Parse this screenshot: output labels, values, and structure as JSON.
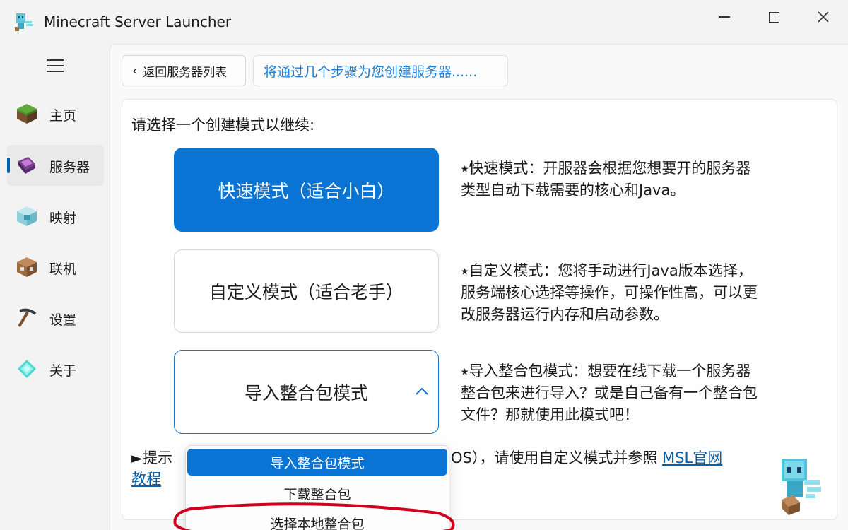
{
  "window": {
    "title": "Minecraft Server Launcher",
    "app_icon": "allay-icon",
    "controls": [
      "minimize-icon",
      "maximize-icon",
      "close-icon"
    ]
  },
  "sidebar": {
    "menu_icon": "hamburger-icon",
    "items": [
      {
        "label": "主页",
        "icon": "grass-block-icon",
        "active": false
      },
      {
        "label": "服务器",
        "icon": "enchanting-book-icon",
        "active": true
      },
      {
        "label": "映射",
        "icon": "beacon-icon",
        "active": false
      },
      {
        "label": "联机",
        "icon": "command-block-icon",
        "active": false
      },
      {
        "label": "设置",
        "icon": "pickaxe-icon",
        "active": false
      },
      {
        "label": "关于",
        "icon": "diamond-icon",
        "active": false
      }
    ]
  },
  "header": {
    "back_label": "返回服务器列表",
    "info_text": "将通过几个步骤为您创建服务器......"
  },
  "main": {
    "prompt": "请选择一个创建模式以继续:",
    "modes": {
      "quick": {
        "label": "快速模式（适合小白）",
        "desc": "⭑快速模式：开服器会根据您想要开的服务器类型自动下载需要的核心和Java。"
      },
      "custom": {
        "label": "自定义模式（适合老手）",
        "desc": "⭑自定义模式：您将手动进行Java版本选择，服务端核心选择等操作，可操作性高，可以更改服务器运行内存和启动参数。"
      },
      "import": {
        "label": "导入整合包模式",
        "desc": "⭑导入整合包模式：想要在线下载一个服务器整合包来进行导入？或是自己备有一个整合包文件？那就使用此模式吧！"
      }
    },
    "tip": {
      "prefix": "►提示",
      "suffix": "OS），请使用自定义模式并参照",
      "link1": "MSL官网",
      "link2": "教程"
    }
  },
  "dropdown": {
    "options": [
      "导入整合包模式",
      "下载整合包",
      "选择本地整合包"
    ],
    "selected": "导入整合包模式"
  },
  "colors": {
    "accent": "#0a74d4",
    "link": "#0a5fa8",
    "annotation": "#d1001f"
  }
}
